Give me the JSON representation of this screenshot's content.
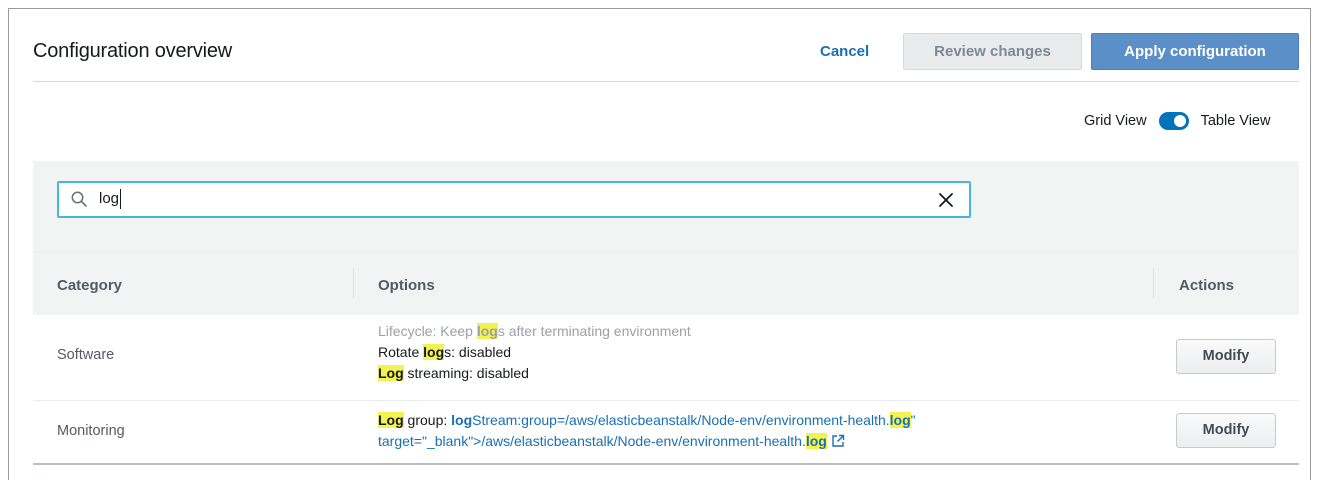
{
  "header": {
    "title": "Configuration overview",
    "cancel_label": "Cancel",
    "review_label": "Review changes",
    "apply_label": "Apply configuration"
  },
  "view_toggle": {
    "left_label": "Grid View",
    "right_label": "Table View",
    "state": "table"
  },
  "search": {
    "value": "log",
    "icons": [
      "search-icon",
      "close-icon"
    ]
  },
  "table": {
    "columns": [
      "Category",
      "Options",
      "Actions"
    ],
    "rows": [
      {
        "category": "Software",
        "options": [
          {
            "pre": "Lifecycle: Keep ",
            "hl": "log",
            "post": "s after terminating environment"
          },
          {
            "pre": "Rotate ",
            "hl": "log",
            "post": "s: disabled"
          },
          {
            "pre": "",
            "hl": "Log",
            "post": " streaming: disabled"
          }
        ],
        "action": "Modify"
      },
      {
        "category": "Monitoring",
        "options": [
          {
            "hl1": "Log",
            "mid1": " group: ",
            "bold1": "log",
            "mid2": "Stream:group=/aws/elasticbeanstalk/Node-env/environment-health.",
            "hl2": "log",
            "post": "\""
          },
          {
            "pre": "target=\"_blank\">/aws/elasticbeanstalk/Node-env/environment-health.",
            "hl": "log"
          }
        ],
        "action": "Modify"
      }
    ]
  },
  "colors": {
    "accent": "#1a6fb3",
    "apply_button": "#5b8fc7",
    "highlight": "#f2f251",
    "search_border": "#44b9d6"
  }
}
